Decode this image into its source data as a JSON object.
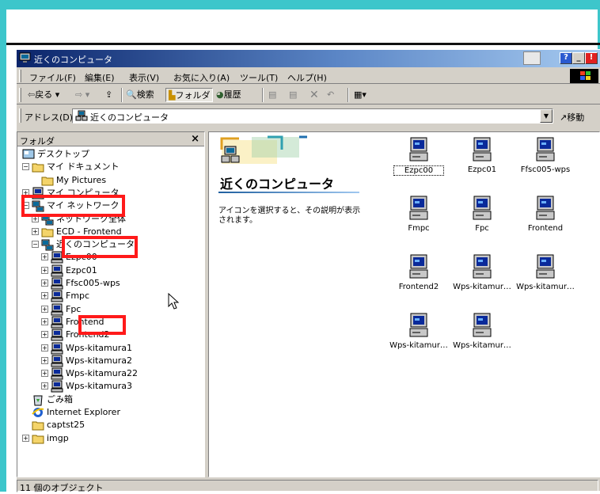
{
  "window": {
    "title": "近くのコンピュータ"
  },
  "menu": [
    "ファイル(F)",
    "編集(E)",
    "表示(V)",
    "お気に入り(A)",
    "ツール(T)",
    "ヘルプ(H)"
  ],
  "toolbar": {
    "back": "戻る",
    "search": "検索",
    "folders": "フォルダ",
    "history": "履歴"
  },
  "address": {
    "label": "アドレス(D)",
    "value": "近くのコンピュータ",
    "go": "移動"
  },
  "folders_pane": {
    "title": "フォルダ",
    "close": "×",
    "tree": [
      {
        "label": "デスクトップ",
        "icon": "desktop-icon"
      },
      {
        "label": "マイ ドキュメント",
        "icon": "folder-icon",
        "exp": "−"
      },
      {
        "label": "My Pictures",
        "icon": "folder-icon"
      },
      {
        "label": "マイ コンピュータ",
        "icon": "computer-icon",
        "exp": "+"
      },
      {
        "label": "マイ ネットワーク",
        "icon": "network-icon",
        "exp": "−"
      },
      {
        "label": "ネットワーク全体",
        "icon": "network-icon",
        "exp": "+"
      },
      {
        "label": "ECD - Frontend",
        "icon": "folder-icon",
        "exp": "+"
      },
      {
        "label": "近くのコンピュータ",
        "icon": "network-icon",
        "exp": "−"
      },
      {
        "label": "Ezpc00",
        "icon": "computer-icon",
        "exp": "+"
      },
      {
        "label": "Ezpc01",
        "icon": "computer-icon",
        "exp": "+"
      },
      {
        "label": "Ffsc005-wps",
        "icon": "computer-icon",
        "exp": "+"
      },
      {
        "label": "Fmpc",
        "icon": "computer-icon",
        "exp": "+"
      },
      {
        "label": "Fpc",
        "icon": "computer-icon",
        "exp": "+"
      },
      {
        "label": "Frontend",
        "icon": "computer-icon",
        "exp": "+"
      },
      {
        "label": "Frontend2",
        "icon": "computer-icon",
        "exp": "+"
      },
      {
        "label": "Wps-kitamura1",
        "icon": "computer-icon",
        "exp": "+"
      },
      {
        "label": "Wps-kitamura2",
        "icon": "computer-icon",
        "exp": "+"
      },
      {
        "label": "Wps-kitamura22",
        "icon": "computer-icon",
        "exp": "+"
      },
      {
        "label": "Wps-kitamura3",
        "icon": "computer-icon",
        "exp": "+"
      },
      {
        "label": "ごみ箱",
        "icon": "recycle-bin-icon"
      },
      {
        "label": "Internet Explorer",
        "icon": "ie-icon"
      },
      {
        "label": "captst25",
        "icon": "folder-icon"
      },
      {
        "label": "imgp",
        "icon": "folder-icon",
        "exp": "+"
      }
    ]
  },
  "view": {
    "heading": "近くのコンピュータ",
    "description": "アイコンを選択すると、その説明が表示されます。",
    "items": [
      "Ezpc00",
      "Ezpc01",
      "Ffsc005-wps",
      "Fmpc",
      "Fpc",
      "Frontend",
      "Frontend2",
      "Wps-kitamur…",
      "Wps-kitamur…",
      "Wps-kitamur…",
      "Wps-kitamur…"
    ]
  },
  "status": {
    "text": "11 個のオブジェクト"
  },
  "colors": {
    "highlight": "#ff1a1a",
    "frame": "#3dc6cb",
    "title_start": "#0a246a"
  }
}
